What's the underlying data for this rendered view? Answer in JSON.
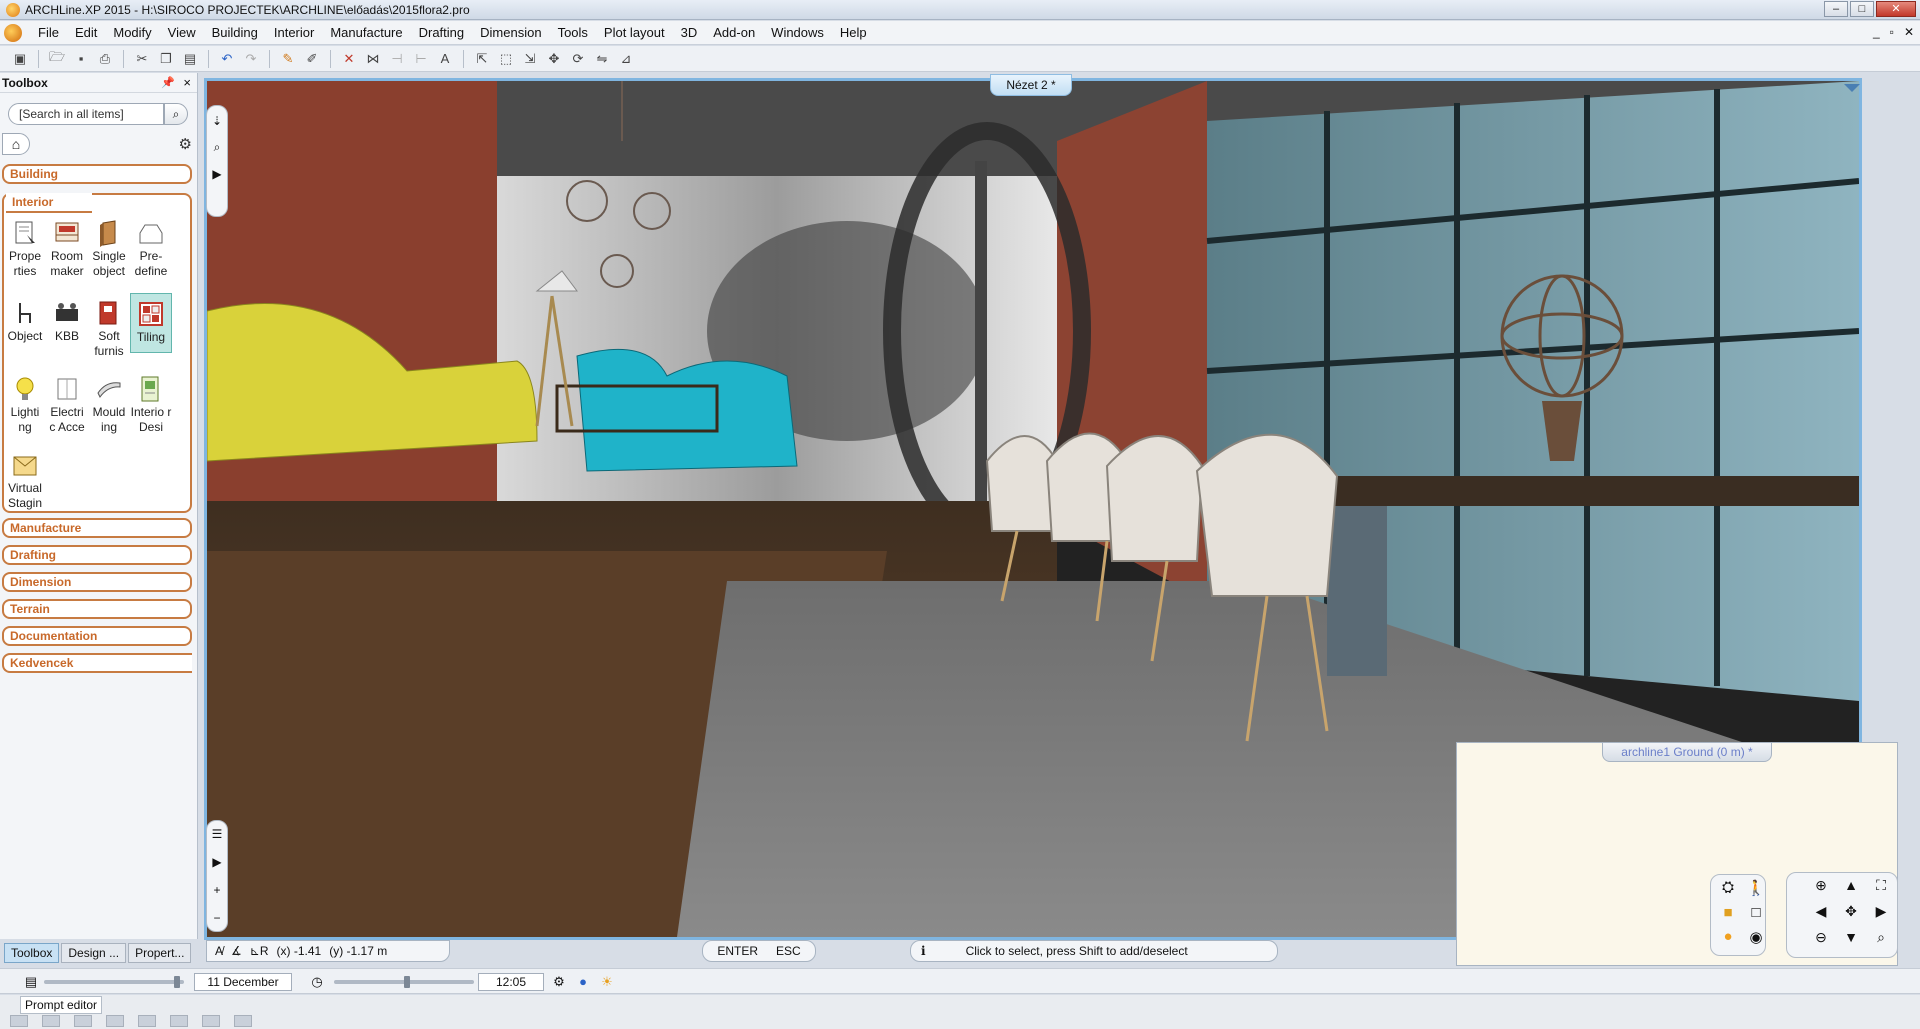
{
  "window": {
    "title": "ARCHLine.XP 2015 - H:\\SIROCO PROJECTEK\\ARCHLINE\\előadás\\2015flora2.pro",
    "controls": [
      "–",
      "□",
      "✕"
    ]
  },
  "menu": {
    "items": [
      "File",
      "Edit",
      "Modify",
      "View",
      "Building",
      "Interior",
      "Manufacture",
      "Drafting",
      "Dimension",
      "Tools",
      "Plot layout",
      "3D",
      "Add-on",
      "Windows",
      "Help"
    ],
    "mdi_controls": [
      "_",
      "▫",
      "✕"
    ]
  },
  "toolbox": {
    "title": "Toolbox",
    "search_placeholder": "[Search in all items]",
    "categories": {
      "building": "Building",
      "interior": "Interior",
      "manufacture": "Manufacture",
      "drafting": "Drafting",
      "dimension": "Dimension",
      "terrain": "Terrain",
      "documentation": "Documentation",
      "kedvencek": "Kedvencek"
    },
    "interior_tools": [
      {
        "label": "Prope rties",
        "icon": "properties-icon"
      },
      {
        "label": "Room maker",
        "icon": "room-maker-icon"
      },
      {
        "label": "Single object",
        "icon": "single-object-icon"
      },
      {
        "label": "Pre-define",
        "icon": "predefine-icon"
      },
      {
        "label": "Object",
        "icon": "object-icon"
      },
      {
        "label": "KBB",
        "icon": "kbb-icon"
      },
      {
        "label": "Soft furnis",
        "icon": "soft-furnishing-icon"
      },
      {
        "label": "Tiling",
        "icon": "tiling-icon"
      },
      {
        "label": "Lighti ng",
        "icon": "lighting-icon"
      },
      {
        "label": "Electri c Acce",
        "icon": "electric-icon"
      },
      {
        "label": "Mould ing",
        "icon": "moulding-icon"
      },
      {
        "label": "Interio r Desi",
        "icon": "interior-design-icon"
      },
      {
        "label": "Virtual Stagin",
        "icon": "virtual-staging-icon"
      }
    ],
    "tabs": [
      "Toolbox",
      "Design ...",
      "Propert..."
    ]
  },
  "viewport": {
    "tab_label": "Nézet 2 *",
    "mini_tab_label": "archline1 Ground (0 m) *"
  },
  "status": {
    "x": "(x) -1.41",
    "y": "(y) -1.17 m",
    "enter": "ENTER",
    "esc": "ESC",
    "info_glyph": "i",
    "message": "Click to select, press Shift to add/deselect"
  },
  "timebar": {
    "date": "11 December",
    "time": "12:05"
  },
  "prompt": {
    "label": "Prompt editor"
  },
  "colors": {
    "accent": "#7fb5e0",
    "category_orange": "#c8692a",
    "active_tool": "#bfe6e2"
  }
}
